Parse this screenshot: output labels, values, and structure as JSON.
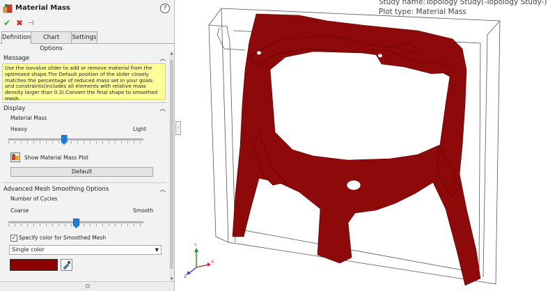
{
  "panel": {
    "title": "Material Mass",
    "help_icon": "?",
    "tabs": [
      "Definition",
      "Chart Options",
      "Settings"
    ],
    "message": {
      "header": "Message",
      "text": "Use the isovalue slider to add or remove material from the optimized shape.The Default  position of the slider closely matches the percentage of reduced mass set in your goals and constraints(includes all elements with relative mass density larger than 0.3).Convert the final shape to smoothed mesh."
    },
    "display": {
      "header": "Display",
      "slider_label": "Material Mass",
      "min_label": "Heavy",
      "max_label": "Light",
      "slider_fraction": 0.41,
      "show_plot_label": "Show Material Mass Plot",
      "default_button": "Default"
    },
    "smoothing": {
      "header": "Advanced Mesh Smoothing Options",
      "cycles_label": "Number of Cycles",
      "min_label": "Coarse",
      "max_label": "Smooth",
      "slider_fraction": 0.5,
      "specify_color_label": "Specify color for Smoothed Mesh",
      "specify_color_checked": true,
      "color_mode": "Single color",
      "mesh_color": "#8b0000"
    }
  },
  "viewport": {
    "study_name": "Study name:Topology Study(-Topology Study-)",
    "plot_type": "Plot type: Material Mass",
    "part_color": "#8e0a0a"
  },
  "colors": {
    "panel_bg": "#f2f2f2",
    "message_bg": "#ffff99",
    "accent": "#1e7fd8"
  }
}
